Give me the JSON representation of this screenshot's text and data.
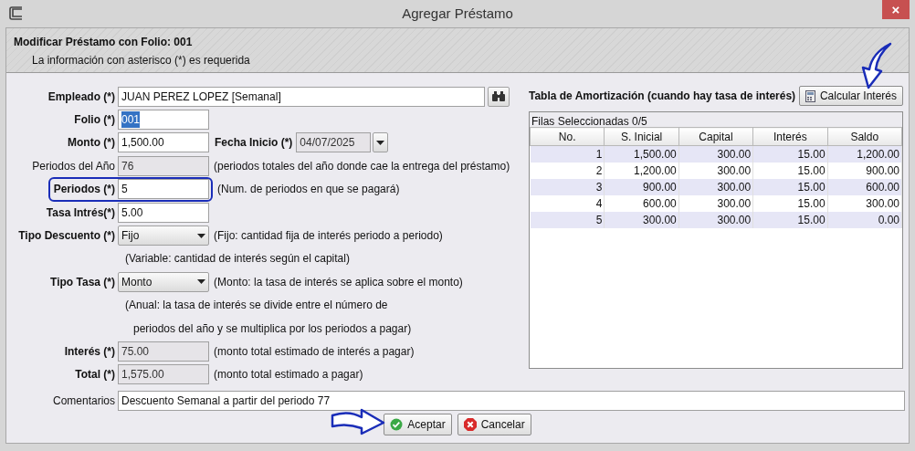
{
  "window": {
    "title": "Agregar Préstamo",
    "close": "×"
  },
  "header": {
    "title": "Modificar Préstamo con Folio: 001",
    "subtitle": "La información con asterisco (*) es requerida"
  },
  "form": {
    "fields": [
      {
        "kind": "lookup",
        "label": "Empleado (*)",
        "bold": true,
        "value": "JUAN PEREZ LOPEZ [Semanal]"
      },
      {
        "kind": "text",
        "label": "Folio (*)",
        "bold": true,
        "value": "001",
        "text_selected": true
      },
      {
        "kind": "text",
        "label": "Monto (*)",
        "bold": true,
        "value": "1,500.00",
        "extra": {
          "label": "Fecha Inicio (*)",
          "value": "04/07/2025"
        }
      },
      {
        "kind": "readonly",
        "label": "Periodos del Año",
        "bold": false,
        "value": "76",
        "hint": "(periodos totales del año donde cae la entrega del préstamo)"
      },
      {
        "kind": "text",
        "label": "Periodos (*)",
        "bold": true,
        "value": "5",
        "hint": "(Num. de periodos en que se pagará)",
        "highlighted": true
      },
      {
        "kind": "text",
        "label": "Tasa Intrés(*)",
        "bold": true,
        "value": "5.00"
      },
      {
        "kind": "select",
        "label": "Tipo Descuento (*)",
        "bold": true,
        "value": "Fijo",
        "hint": "(Fijo: cantidad fija de interés periodo a periodo)"
      },
      {
        "kind": "note",
        "hint": "(Variable: cantidad de interés según el capital)"
      },
      {
        "kind": "select",
        "label": "Tipo Tasa (*)",
        "bold": true,
        "value": "Monto",
        "hint": "(Monto: la tasa de interés se aplica sobre el monto)"
      },
      {
        "kind": "note",
        "hint": "(Anual: la tasa de interés se divide entre el número de"
      },
      {
        "kind": "note",
        "hint": "periodos del año y se multiplica por los periodos a pagar)",
        "indent": true
      },
      {
        "kind": "readonly",
        "label": "Interés (*)",
        "bold": true,
        "value": "75.00",
        "hint": "(monto total estimado de interés a pagar)"
      },
      {
        "kind": "readonly",
        "label": "Total (*)",
        "bold": true,
        "value": "1,575.00",
        "hint": "(monto total estimado a pagar)"
      }
    ],
    "comments": {
      "label": "Comentarios",
      "value": "Descuento Semanal a partir del periodo 77"
    }
  },
  "amortization": {
    "title": "Tabla de Amortización (cuando hay tasa de interés)",
    "button": {
      "label": "Calcular Interés",
      "pointer_arrow": true
    },
    "selection_caption": "Filas Seleccionadas  0/5",
    "columns": [
      "No.",
      "S. Inicial",
      "Capital",
      "Interés",
      "Saldo"
    ],
    "rows": [
      [
        "1",
        "1,500.00",
        "300.00",
        "15.00",
        "1,200.00"
      ],
      [
        "2",
        "1,200.00",
        "300.00",
        "15.00",
        "900.00"
      ],
      [
        "3",
        "900.00",
        "300.00",
        "15.00",
        "600.00"
      ],
      [
        "4",
        "600.00",
        "300.00",
        "15.00",
        "300.00"
      ],
      [
        "5",
        "300.00",
        "300.00",
        "15.00",
        "0.00"
      ]
    ]
  },
  "buttons": [
    {
      "kind": "accept",
      "label": "Aceptar",
      "pointer_arrow": true
    },
    {
      "kind": "cancel",
      "label": "Cancelar",
      "pointer_arrow": false
    }
  ]
}
